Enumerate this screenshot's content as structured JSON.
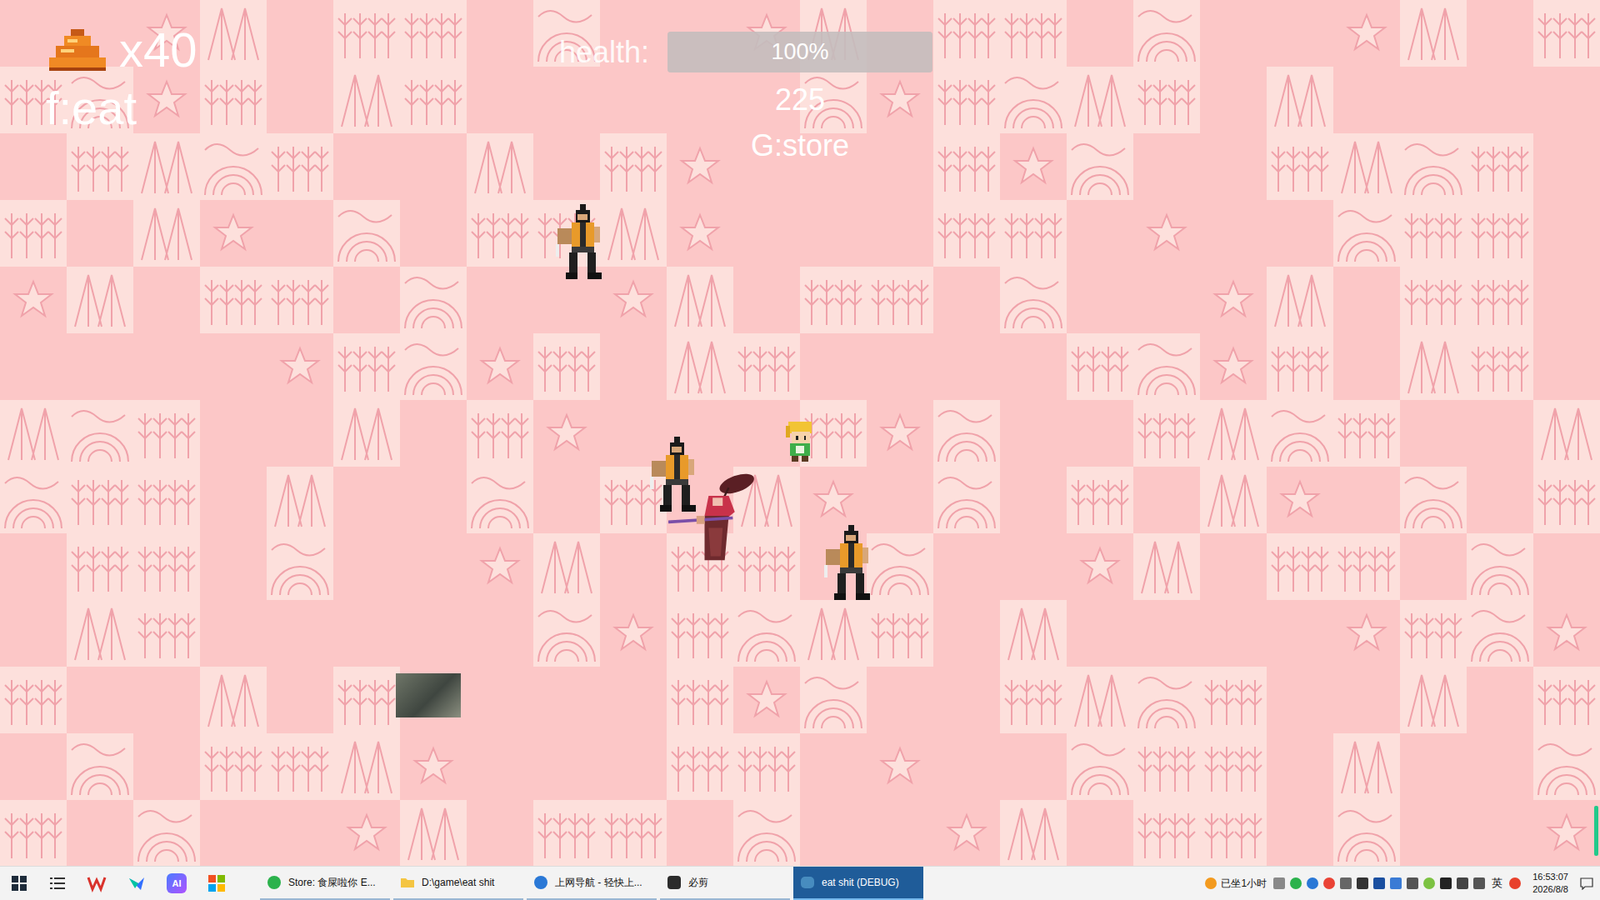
{
  "window": {
    "title": "eat shit (DEBUG)"
  },
  "hud": {
    "poop_count": "x40",
    "eat_hint": "f:eat",
    "health_label": "health:",
    "health": {
      "level": 1.0,
      "reading": "100%"
    },
    "score": "225",
    "store_hint": "G:store"
  },
  "entities": [
    {
      "kind": "warrior"
    },
    {
      "kind": "warrior"
    },
    {
      "kind": "warrior"
    },
    {
      "kind": "player"
    },
    {
      "kind": "boss"
    },
    {
      "kind": "photo"
    }
  ],
  "taskbar": {
    "pinned": [
      {
        "kind": "wps",
        "label": ""
      },
      {
        "kind": "feishu",
        "label": ""
      },
      {
        "kind": "ai",
        "label": "AI"
      },
      {
        "kind": "tiles",
        "label": ""
      }
    ],
    "windows": [
      {
        "label": "Store: 食屎啦你 E...",
        "kind": "browser",
        "selected": false
      },
      {
        "label": "D:\\game\\eat shit",
        "kind": "folder",
        "selected": false
      },
      {
        "label": "上网导航 - 轻快上...",
        "kind": "sogou",
        "selected": false
      },
      {
        "label": "必剪",
        "kind": "bijian",
        "selected": false
      },
      {
        "label": "eat shit (DEBUG)",
        "kind": "godot",
        "selected": true
      }
    ],
    "tray": {
      "status": "已坐1小时",
      "ime": "英",
      "time": "16:53:07",
      "date": "2026/8/8"
    }
  }
}
